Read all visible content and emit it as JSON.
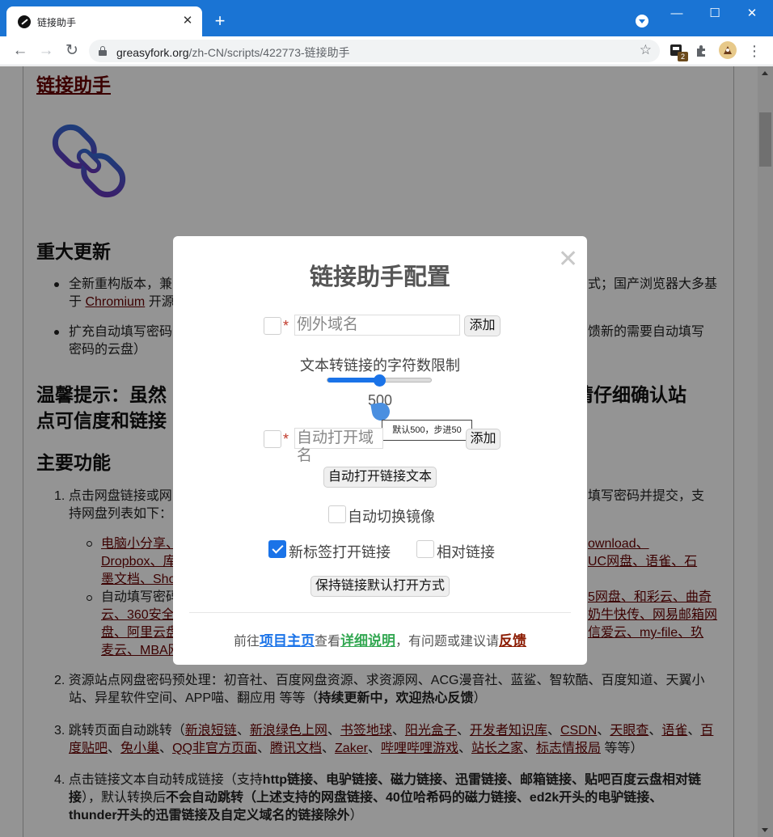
{
  "browser": {
    "tab_title": "链接助手",
    "tab_close": "✕",
    "new_tab": "+",
    "win_minimize": "—",
    "win_maximize": "☐",
    "win_close": "✕",
    "url_domain": "greasyfork.org",
    "url_path": "/zh-CN/scripts/422773-链接助手",
    "extension_badge": "2",
    "icons": [
      "back-icon",
      "forward-icon",
      "reload-icon",
      "lock-icon",
      "star-icon",
      "extension-icon",
      "puzzle-icon",
      "profile-icon",
      "menu-icon"
    ]
  },
  "page": {
    "script_title": "链接助手",
    "h_update": "重大更新",
    "update_1a": "全新重构版本，兼",
    "update_1b": "式；国产浏览器大多基",
    "update_1c_pre": "于",
    "update_1c_link": "Chromium",
    "update_1c_post": "开源",
    "update_2a": "扩充自动填写密码",
    "update_2b": "馈新的需要自动填写",
    "update_2c": "密码的云盘）",
    "h_tip_a": "温馨提示：虽然",
    "h_tip_b": "请仔细确认站",
    "h_tip_c": "点可信度和链接",
    "h_features": "主要功能",
    "f1_a": "1. 点击网盘链接或网",
    "f1_b": "填写密码并提交，支",
    "f1_c": "持网盘列表如下：",
    "sub1_a": "电脑小分享、",
    "sub1_b": "ownload、",
    "sub1_c": "Dropbox、库",
    "sub1_d": "UC网盘、语雀、石",
    "sub1_e": "墨文档、Sho",
    "sub2_a": "自动填写密码",
    "sub2_b": "5网盘、和彩云、曲奇",
    "sub2_c": "云、360安全",
    "sub2_d": "奶牛快传、网易邮箱网",
    "sub2_e": "盘、阿里云盘",
    "sub2_f": "信爱云、my-file、玖",
    "sub2_g": "麦云、MBA网",
    "f2_a": "2. 资源站点网盘密码预处理：初音社、百度网盘资源、求资源网、ACG漫音社、蓝鲨、智软酷、百度知道、天翼小",
    "f2_b": "站、异星软件空间、APP喵、翻应用 等等（",
    "f2_c": "持续更新中，欢迎热心反馈",
    "f2_d": "）",
    "f3_a_pre": "3. 跳转页面自动跳转（",
    "f3_links_a": [
      "新浪短链",
      "新浪绿色上网",
      "书签地球",
      "阳光盒子",
      "开发者知识库",
      "CSDN",
      "天眼查",
      "语雀",
      "百"
    ],
    "f3_links_b": [
      "度贴吧",
      "兔小巢",
      "QQ非官方页面",
      "腾讯文档",
      "Zaker",
      "哔哩哔哩游戏",
      "站长之家",
      "标志情报局"
    ],
    "f3_b_post": " 等等）",
    "f4_a_pre": "4. 点击链接文本自动转成链接（支持",
    "f4_a_bold": "http链接、电驴链接、磁力链接、迅雷链接、邮箱链接、贴吧百度云盘相对链",
    "f4_b_bold1": "接",
    "f4_b_mid": "），默认转换后",
    "f4_b_bold2": "不会自动跳转（上述支持的网盘链接、40位哈希码的磁力链接、ed2k开头的电驴链接、",
    "f4_c_bold": "thunder开头的迅雷链接及自定义域名的链接除外",
    "f4_c_post": "）"
  },
  "dialog": {
    "title": "链接助手配置",
    "close": "✕",
    "required_mark": "*",
    "exclude_domain_placeholder": "例外域名",
    "add_button": "添加",
    "limit_label": "文本转链接的字符数限制",
    "slider_value": "500",
    "slider_fraction": 0.5,
    "tooltip": "默认500，步进50",
    "auto_open_placeholder": "自动打开域名",
    "auto_open_text_button": "自动打开链接文本",
    "mirror_label": "自动切换镜像",
    "new_tab_label": "新标签打开链接",
    "new_tab_checked": true,
    "relative_label": "相对链接",
    "relative_checked": false,
    "keep_default_button": "保持链接默认打开方式",
    "footer_pre": "前往",
    "footer_home": "项目主页",
    "footer_mid1": "查看",
    "footer_detail": "详细说明",
    "footer_mid2": "，有问题或建议请",
    "footer_feedback": "反馈"
  },
  "colors": {
    "titlebar": "#1a74d4",
    "accent": "#1a73e8",
    "link": "#670000",
    "footer_green": "#34a853"
  }
}
